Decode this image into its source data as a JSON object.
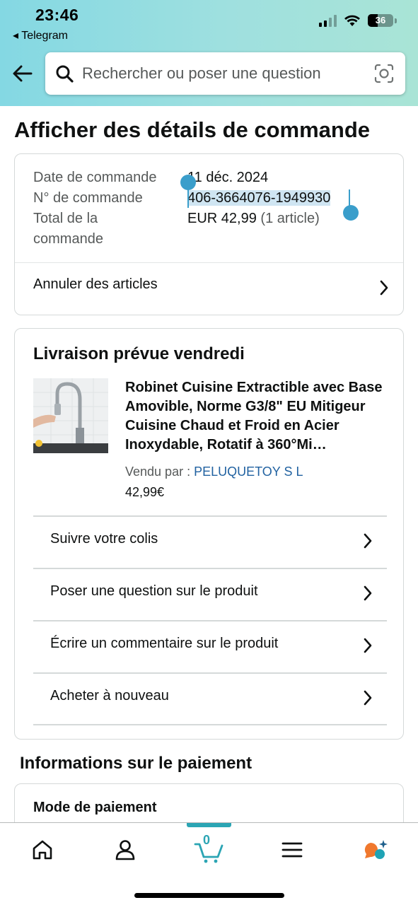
{
  "status_bar": {
    "time": "23:46",
    "back_app": "◂ Telegram",
    "battery": "36"
  },
  "search": {
    "placeholder": "Rechercher ou poser une question"
  },
  "page": {
    "title": "Afficher des détails de commande"
  },
  "order": {
    "date_label": "Date de commande",
    "date_value": "11 déc. 2024",
    "number_label": "N° de commande",
    "number_value": "406-3664076-1949930",
    "total_label_1": "Total de la",
    "total_label_2": "commande",
    "total_value": "EUR 42,99",
    "total_items": "(1 article)",
    "cancel_label": "Annuler des articles"
  },
  "shipment": {
    "heading": "Livraison prévue vendredi",
    "product_title": "Robinet Cuisine Extractible avec Base Amovible, Norme G3/8\" EU Mitigeur Cuisine Chaud et Froid en Acier Inoxydable, Rotatif à 360°Mi…",
    "sold_by_label": "Vendu par  : ",
    "seller": "PELUQUETOY S L",
    "price": "42,99€",
    "actions": [
      {
        "label": "Suivre votre colis"
      },
      {
        "label": "Poser une question sur le produit"
      },
      {
        "label": "Écrire un commentaire sur le produit"
      },
      {
        "label": "Acheter à nouveau"
      }
    ]
  },
  "payment": {
    "heading": "Informations sur le paiement",
    "method_label": "Mode de paiement"
  },
  "tabbar": {
    "cart_count": "0"
  },
  "colors": {
    "accent": "#2ba5b4",
    "link": "#2162a1",
    "selection_handle": "#3a9ecb"
  }
}
